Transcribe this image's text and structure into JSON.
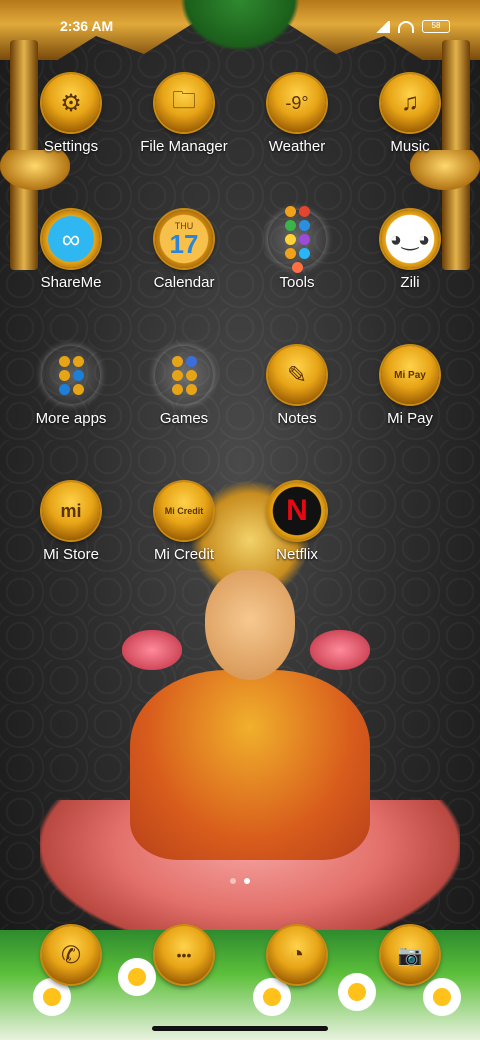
{
  "status_bar": {
    "time": "2:36 AM",
    "battery": "58"
  },
  "apps": [
    {
      "label": "Settings",
      "icon": "gear-icon",
      "glyph": "⚙"
    },
    {
      "label": "File Manager",
      "icon": "folder-icon",
      "glyph": "🗀"
    },
    {
      "label": "Weather",
      "icon": "weather-icon",
      "glyph": "-9°"
    },
    {
      "label": "Music",
      "icon": "music-icon",
      "glyph": "♫"
    },
    {
      "label": "ShareMe",
      "icon": "shareme-icon",
      "glyph": "∞"
    },
    {
      "label": "Calendar",
      "icon": "calendar-icon",
      "day": "THU",
      "date": "17"
    },
    {
      "label": "Tools",
      "icon": "tools-folder-icon"
    },
    {
      "label": "Zili",
      "icon": "zili-icon",
      "glyph": "◕‿◕"
    },
    {
      "label": "More apps",
      "icon": "more-apps-folder-icon"
    },
    {
      "label": "Games",
      "icon": "games-folder-icon"
    },
    {
      "label": "Notes",
      "icon": "notes-icon",
      "glyph": "✎"
    },
    {
      "label": "Mi Pay",
      "icon": "mi-pay-icon",
      "glyph": "Mi Pay"
    },
    {
      "label": "Mi Store",
      "icon": "mi-store-icon",
      "glyph": "mi"
    },
    {
      "label": "Mi Credit",
      "icon": "mi-credit-icon",
      "glyph": "Mi Credit"
    },
    {
      "label": "Netflix",
      "icon": "netflix-icon",
      "glyph": "N"
    }
  ],
  "dock": [
    {
      "icon": "phone-icon",
      "glyph": "✆"
    },
    {
      "icon": "messages-icon",
      "glyph": "•••"
    },
    {
      "icon": "browser-icon",
      "glyph": "◔"
    },
    {
      "icon": "camera-icon",
      "glyph": "📷"
    }
  ],
  "colors": {
    "gold": "#e7a416",
    "tools_dots": [
      "#f2a21a",
      "#e3452f",
      "#3bb34a",
      "#2b8fe0",
      "#ffd23a",
      "#9c4bd8",
      "#f2a21a",
      "#29b6f6",
      "#ff7043"
    ],
    "more_apps_dots": [
      "#e7a416",
      "#e7a416",
      "#e7a416",
      "#1d7fd6",
      "#1d7fd6",
      "#e7a416"
    ],
    "games_dots": [
      "#e7a416",
      "#3b6ed8",
      "#e7a416",
      "#e7a416",
      "#e7a416",
      "#e7a416"
    ]
  }
}
